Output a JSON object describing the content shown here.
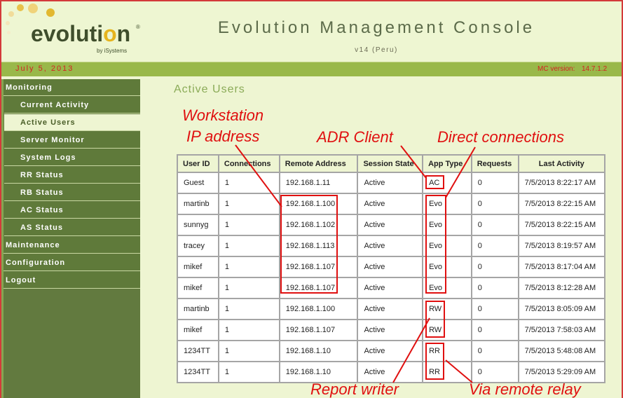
{
  "header": {
    "logo_word": "evolution",
    "logo_reg": "®",
    "logo_sub": "by iSystems",
    "title": "Evolution Management Console",
    "version": "v14 (Peru)"
  },
  "datebar": {
    "date": "July 5, 2013",
    "mc_version_label": "MC version:",
    "mc_version_value": "14.7.1.2"
  },
  "sidebar": {
    "items": [
      {
        "label": "Monitoring"
      },
      {
        "label": "Current Activity"
      },
      {
        "label": "Active Users"
      },
      {
        "label": "Server Monitor"
      },
      {
        "label": "System Logs"
      },
      {
        "label": "RR Status"
      },
      {
        "label": "RB Status"
      },
      {
        "label": "AC Status"
      },
      {
        "label": "AS Status"
      },
      {
        "label": "Maintenance"
      },
      {
        "label": "Configuration"
      },
      {
        "label": "Logout"
      }
    ]
  },
  "main": {
    "title": "Active Users",
    "table": {
      "headers": [
        "User ID",
        "Connections",
        "Remote Address",
        "Session State",
        "App Type",
        "Requests",
        "Last Activity"
      ],
      "rows": [
        [
          "Guest",
          "1",
          "192.168.1.11",
          "Active",
          "AC",
          "0",
          "7/5/2013 8:22:17 AM"
        ],
        [
          "martinb",
          "1",
          "192.168.1.100",
          "Active",
          "Evo",
          "0",
          "7/5/2013 8:22:15 AM"
        ],
        [
          "sunnyg",
          "1",
          "192.168.1.102",
          "Active",
          "Evo",
          "0",
          "7/5/2013 8:22:15 AM"
        ],
        [
          "tracey",
          "1",
          "192.168.1.113",
          "Active",
          "Evo",
          "0",
          "7/5/2013 8:19:57 AM"
        ],
        [
          "mikef",
          "1",
          "192.168.1.107",
          "Active",
          "Evo",
          "0",
          "7/5/2013 8:17:04 AM"
        ],
        [
          "mikef",
          "1",
          "192.168.1.107",
          "Active",
          "Evo",
          "0",
          "7/5/2013 8:12:28 AM"
        ],
        [
          "martinb",
          "1",
          "192.168.1.100",
          "Active",
          "RW",
          "0",
          "7/5/2013 8:05:09 AM"
        ],
        [
          "mikef",
          "1",
          "192.168.1.107",
          "Active",
          "RW",
          "0",
          "7/5/2013 7:58:03 AM"
        ],
        [
          "1234TT",
          "1",
          "192.168.1.10",
          "Active",
          "RR",
          "0",
          "7/5/2013 5:48:08 AM"
        ],
        [
          "1234TT",
          "1",
          "192.168.1.10",
          "Active",
          "RR",
          "0",
          "7/5/2013 5:29:09 AM"
        ]
      ]
    }
  },
  "annotations": {
    "workstation_line1": "Workstation",
    "workstation_line2": "IP address",
    "adr_client": "ADR Client",
    "direct_connections": "Direct connections",
    "report_writer": "Report writer",
    "via_remote_relay": "Via remote relay"
  },
  "colors": {
    "accent_red": "#e01010",
    "sidebar_green": "#5f7a3a",
    "datebar_green": "#99b84a",
    "page_bg": "#eef5d2"
  }
}
